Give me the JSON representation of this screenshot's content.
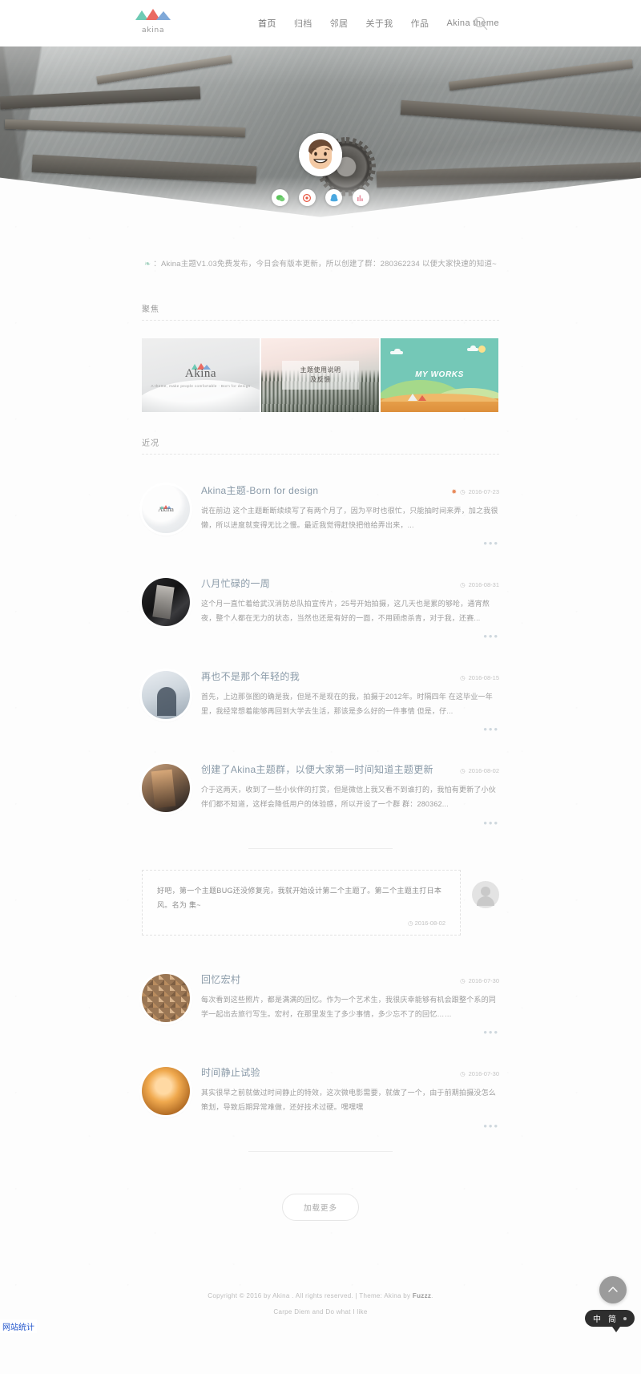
{
  "header": {
    "logo_word": "akina",
    "nav": [
      {
        "label": "首页",
        "active": true
      },
      {
        "label": "归档",
        "active": false
      },
      {
        "label": "邻居",
        "active": false
      },
      {
        "label": "关于我",
        "active": false
      },
      {
        "label": "作品",
        "active": false
      },
      {
        "label": "Akina theme",
        "active": false
      }
    ],
    "search_icon": "search-icon"
  },
  "hero": {
    "avatar_alt": "avatar",
    "social": [
      {
        "name": "wechat-icon",
        "glyph": "✆",
        "color": "#5cc45c"
      },
      {
        "name": "weibo-icon",
        "glyph": "✿",
        "color": "#e8553f"
      },
      {
        "name": "qq-icon",
        "glyph": "❦",
        "color": "#4aa8e0"
      },
      {
        "name": "music-icon",
        "glyph": "♫",
        "color": "#e88fa0"
      }
    ]
  },
  "notice": {
    "icon": "leaf-icon",
    "text": "：Akina主题V1.03免费发布，今日会有版本更新，所以创建了群：280362234 以便大家快速的知道~"
  },
  "focus": {
    "heading": "聚焦",
    "cards": [
      {
        "name": "card-akina",
        "title": "Akina",
        "subtitle": "A theme, make people comfortable · Born for design"
      },
      {
        "name": "card-usage",
        "title": "主题使用说明\n及反馈",
        "line1": "主题使用说明",
        "line2": "及反馈"
      },
      {
        "name": "card-works",
        "title": "MY WORKS"
      }
    ]
  },
  "recent": {
    "heading": "近况",
    "posts": [
      {
        "thumb": "t-akina",
        "title": "Akina主题-Born for design",
        "hot": true,
        "date": "2016-07-23",
        "excerpt": "说在前边 这个主题断断续续写了有两个月了，因为平时也很忙，只能抽时间来弄，加之我很懒，所以进度就变得无比之慢。最近我觉得赶快把他给弄出来，...",
        "more": "•••"
      },
      {
        "thumb": "t-fire",
        "title": "八月忙碌的一周",
        "hot": false,
        "date": "2016-08-31",
        "excerpt": "这个月一直忙着给武汉消防总队拍宣传片，25号开始拍摄，这几天也是累的够呛，通宵熬夜，整个人都在无力的状态，当然也还是有好的一面，不用顾虑杀青，对于我，还赛...",
        "more": "•••"
      },
      {
        "thumb": "t-blue",
        "title": "再也不是那个年轻的我",
        "hot": false,
        "date": "2016-08-15",
        "excerpt": "首先，上边那张图的确是我，但是不是现在的我，拍摄于2012年。时隔四年 在这毕业一年里，我经常想着能够再回到大学去生活，那该是多么好的一件事情 但是，仔...",
        "more": "•••"
      },
      {
        "thumb": "t-orange",
        "title": "创建了Akina主题群，以便大家第一时间知道主题更新",
        "hot": false,
        "date": "2016-08-02",
        "excerpt": "介于这两天，收到了一些小伙伴的打赏，但是微信上我又看不到谁打的，我怕有更新了小伙伴们都不知道，这样会降低用户的体验感，所以开设了一个群 群：280362...",
        "more": "•••"
      }
    ],
    "quote": {
      "text": "好吧，第一个主题BUG还没修复完，我就开始设计第二个主题了。第二个主题主打日本风。名为 集~",
      "date": "2016-08-02",
      "clock_icon": "clock-icon"
    },
    "posts_after": [
      {
        "thumb": "t-collage",
        "title": "回忆宏村",
        "hot": false,
        "date": "2016-07-30",
        "excerpt": "每次看到这些照片，都是满满的回忆。作为一个艺术生，我很庆幸能够有机会跟整个系的同学一起出去旅行写生。宏村，在那里发生了多少事情，多少忘不了的回忆……",
        "more": "•••"
      },
      {
        "thumb": "t-amber",
        "title": "时间静止试验",
        "hot": false,
        "date": "2016-07-30",
        "excerpt": "其实很早之前就做过时间静止的特效，这次微电影需要，就做了一个，由于前期拍摄没怎么策划，导致后期异常难做，还好技术过硬。嘿嘿嘿",
        "more": "•••"
      }
    ],
    "load_more": "加载更多"
  },
  "footer": {
    "copyright_before": "Copyright © 2016 by Akina . All rights reserved.  |  Theme: Akina by ",
    "author": "Fuzzz",
    "copyright_after": ".",
    "slogan": "Carpe Diem and Do what I like",
    "to_top_icon": "chevron-up-icon"
  },
  "os": {
    "ime_lang": "中",
    "ime_mode": "简",
    "status_text": "网站统计"
  },
  "colors": {
    "accent_teal": "#6ec5b4",
    "title_blue": "#8a9aa8",
    "hot_orange": "#e8895a",
    "text_muted": "#9d9d9d"
  }
}
